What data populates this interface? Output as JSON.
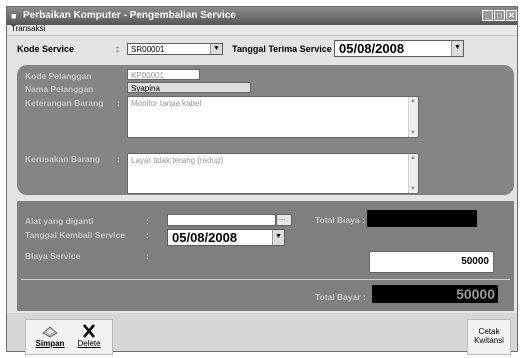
{
  "window": {
    "title": "Perbaikan Komputer - Pengembalian Service",
    "minimize_glyph": "_",
    "maximize_glyph": "□",
    "close_glyph": "✕"
  },
  "menu": {
    "items": [
      "Transaksi"
    ]
  },
  "header": {
    "kode_service_label": "Kode Service",
    "kode_service_value": "SR00001",
    "tanggal_terima_label": "Tanggal Terima Service :",
    "tanggal_terima_value": "05/08/2008"
  },
  "customer": {
    "kode_pelanggan_label": "Kode Pelanggan",
    "kode_pelanggan_value": "KP00001",
    "nama_pelanggan_label": "Nama Pelanggan",
    "nama_pelanggan_value": "Syapina",
    "keterangan_label": "Keterangan Barang",
    "keterangan_value": "Monitor tanpa kabel",
    "kerusakan_label": "Kerusakan Barang",
    "kerusakan_value": "Layar tidak terang (redup)"
  },
  "service": {
    "alat_label": "Alat yang diganti",
    "alat_value": "",
    "browse_label": "....",
    "total_biaya_label": "Total Biaya :",
    "tanggal_kembali_label": "Tanggal Kembali Service",
    "tanggal_kembali_value": "05/08/2008",
    "biaya_label": "Biaya Service",
    "biaya_value": "50000",
    "total_bayar_label": "Total Bayar :",
    "total_bayar_value": "50000"
  },
  "colon": ":",
  "arrow_glyph": "▼",
  "scroll_up": "▲",
  "scroll_down": "▼",
  "buttons": {
    "simpan": "Simpan",
    "delete": "Delete",
    "cetak": "Cetak Kwitansi"
  }
}
